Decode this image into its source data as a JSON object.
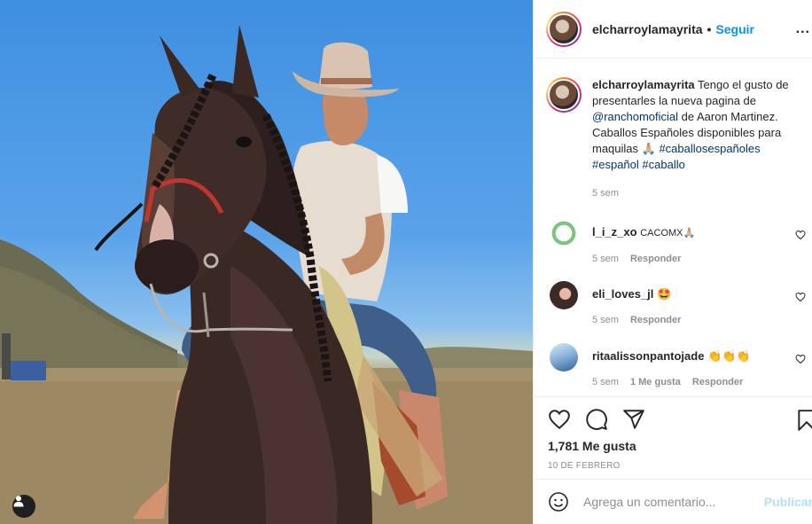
{
  "header": {
    "username": "elcharroylamayrita",
    "separator": "•",
    "follow_label": "Seguir",
    "more_label": "..."
  },
  "caption": {
    "username": "elcharroylamayrita",
    "text_1": "Tengo el gusto de presentarles la nueva pagina de ",
    "mention": "@ranchomoficial",
    "text_2": " de Aaron Martinez. Caballos Españoles disponibles para maquilas 🙏🏼 ",
    "hashtag_1": "#caballosespañoles",
    "hashtag_2": "#español",
    "hashtag_3": "#caballo",
    "time": "5 sem"
  },
  "comments": [
    {
      "username": "l_i_z_xo",
      "text": "CACOMX🙏🏼",
      "time": "5 sem",
      "reply": "Responder",
      "likes": ""
    },
    {
      "username": "eli_loves_jl",
      "text": "🤩",
      "time": "5 sem",
      "reply": "Responder",
      "likes": ""
    },
    {
      "username": "ritaalissonpantojade",
      "text": "👏👏👏",
      "time": "5 sem",
      "reply": "Responder",
      "likes": "1 Me gusta"
    }
  ],
  "actions": {
    "likes_count": "1,781 Me gusta",
    "date": "10 DE FEBRERO"
  },
  "add_comment": {
    "placeholder": "Agrega un comentario...",
    "post_label": "Publicar"
  },
  "icons": {
    "like": "heart-icon",
    "comment": "comment-bubble-icon",
    "share": "paper-plane-icon",
    "save": "bookmark-icon",
    "emoji": "smiley-icon",
    "tag": "user-tag-icon"
  },
  "colors": {
    "accent": "#0095f6",
    "link": "#00376b",
    "muted": "#8e8e8e",
    "post_disabled": "#b2dffc",
    "border": "#efefef"
  }
}
